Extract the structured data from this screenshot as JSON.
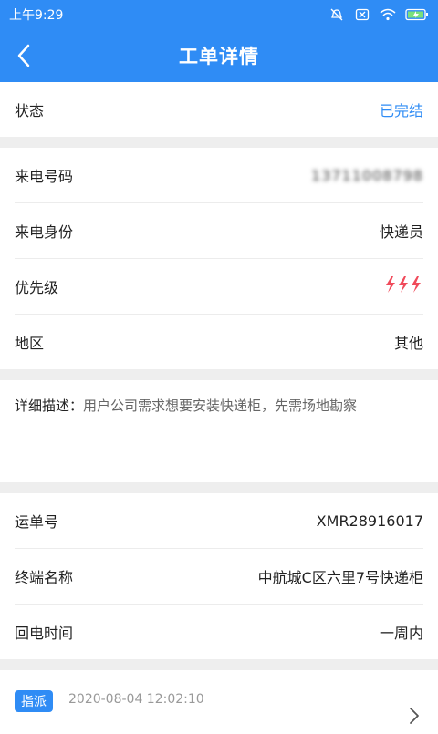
{
  "status_bar": {
    "time": "上午9:29"
  },
  "header": {
    "title": "工单详情"
  },
  "status_section": {
    "label": "状态",
    "value": "已完结"
  },
  "caller_section": {
    "rows": [
      {
        "label": "来电号码",
        "value": "13711008798"
      },
      {
        "label": "来电身份",
        "value": "快递员"
      },
      {
        "label": "优先级",
        "value": ""
      },
      {
        "label": "地区",
        "value": "其他"
      }
    ]
  },
  "description": {
    "label": "详细描述：",
    "text": "用户公司需求想要安装快递柜，先需场地勘察"
  },
  "order_section": {
    "rows": [
      {
        "label": "运单号",
        "value": "XMR28916017"
      },
      {
        "label": "终端名称",
        "value": "中航城C区六里7号快递柜"
      },
      {
        "label": "回电时间",
        "value": "一周内"
      }
    ]
  },
  "log": {
    "badge": "指派",
    "timestamp": "2020-08-04 12:02:10"
  },
  "colors": {
    "primary": "#2f8cf5",
    "priority": "#f04a5a"
  }
}
